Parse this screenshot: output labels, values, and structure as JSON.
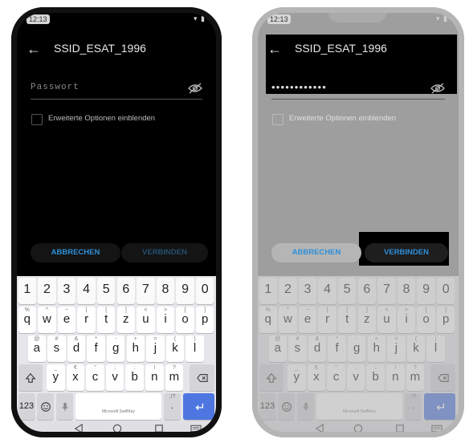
{
  "status": {
    "time": "12:13"
  },
  "header": {
    "back_icon": "arrow-left-icon",
    "ssid": "SSID_ESAT_1996"
  },
  "password": {
    "placeholder": "Passwort",
    "masked_value": "••••••••••••",
    "visibility_icon": "eye-off-icon"
  },
  "advanced": {
    "label": "Erweiterte Optionen einblenden",
    "checked": false
  },
  "buttons": {
    "cancel": "ABBRECHEN",
    "connect": "VERBINDEN"
  },
  "keyboard": {
    "number_row": [
      "1",
      "2",
      "3",
      "4",
      "5",
      "6",
      "7",
      "8",
      "9",
      "0"
    ],
    "row1": {
      "keys": [
        "q",
        "w",
        "e",
        "r",
        "t",
        "z",
        "u",
        "i",
        "o",
        "p"
      ],
      "alts": [
        "%",
        "^",
        "~",
        "|",
        "[",
        "]",
        "<",
        ">",
        "{",
        "}"
      ]
    },
    "row2": {
      "keys": [
        "a",
        "s",
        "d",
        "f",
        "g",
        "h",
        "j",
        "k",
        "l"
      ],
      "alts": [
        "@",
        "#",
        "&",
        "*",
        "-",
        "+",
        "=",
        "(",
        ")"
      ]
    },
    "row3": {
      "keys": [
        "y",
        "x",
        "c",
        "v",
        "b",
        "n",
        "m"
      ],
      "alts": [
        "_",
        "€",
        "\"",
        ";",
        ":",
        "!",
        "?"
      ]
    },
    "bottom": {
      "numbers_label": "123",
      "emoji_icon": "smiley-icon",
      "mic_icon": "microphone-icon",
      "space_label": "Microsoft SwiftKey",
      "period_label": ".",
      "period_alt": ",!?",
      "shift_icon": "shift-icon",
      "backspace_icon": "backspace-icon",
      "enter_icon": "enter-icon"
    }
  },
  "navbar": {
    "icons": [
      "back-triangle-icon",
      "home-circle-icon",
      "recents-square-icon",
      "keyboard-icon"
    ]
  },
  "colors": {
    "accent_blue": "#2e8fd9",
    "enter_key": "#4e76e0"
  }
}
